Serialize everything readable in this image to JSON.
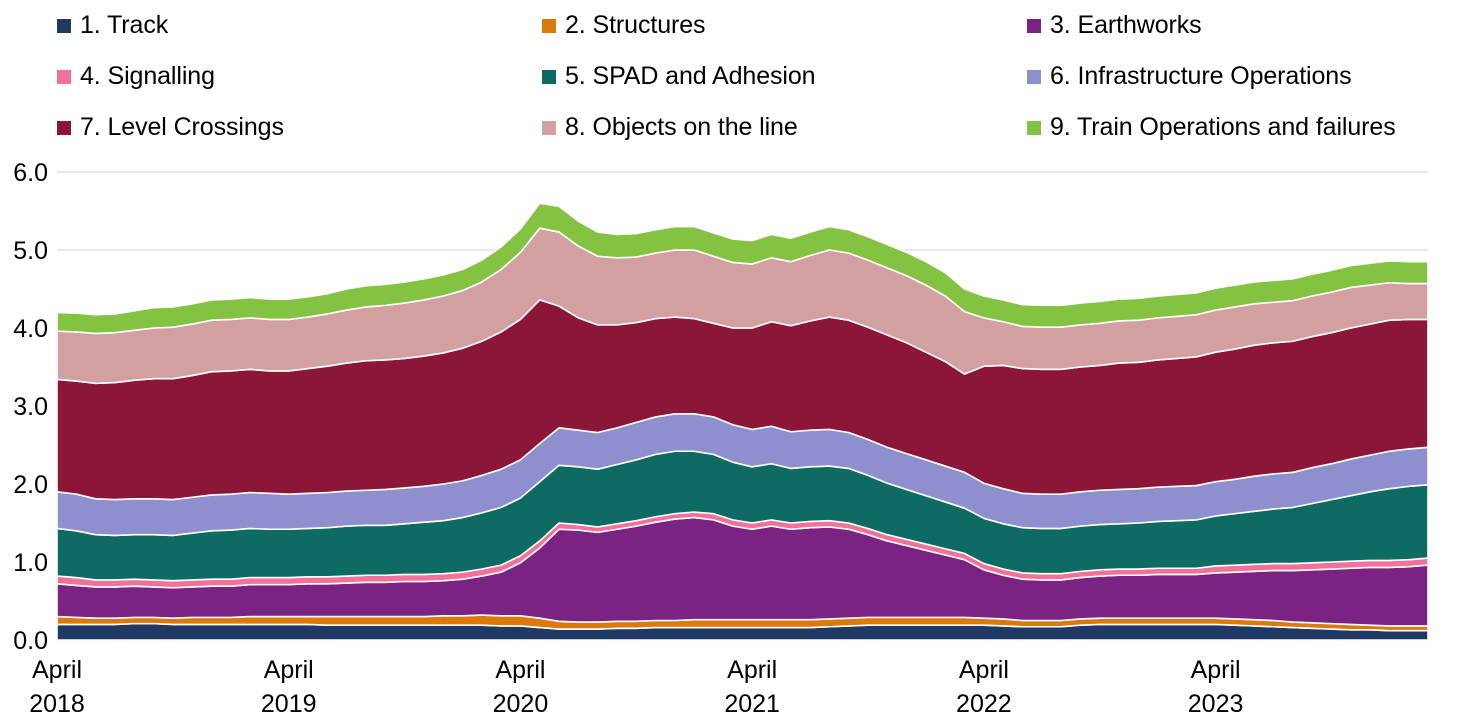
{
  "legend": {
    "position": "top",
    "items": [
      {
        "label": "1. Track",
        "color": "#1F3864",
        "icon": "square-swatch-icon"
      },
      {
        "label": "2. Structures",
        "color": "#D97A0B",
        "icon": "square-swatch-icon"
      },
      {
        "label": "3. Earthworks",
        "color": "#7B2382",
        "icon": "square-swatch-icon"
      },
      {
        "label": "4. Signalling",
        "color": "#F2719B",
        "icon": "square-swatch-icon"
      },
      {
        "label": "5. SPAD and Adhesion",
        "color": "#0D6B63",
        "icon": "square-swatch-icon"
      },
      {
        "label": "6. Infrastructure Operations",
        "color": "#8E90CE",
        "icon": "square-swatch-icon"
      },
      {
        "label": "7. Level Crossings",
        "color": "#8C1637",
        "icon": "square-swatch-icon"
      },
      {
        "label": "8. Objects on the line",
        "color": "#D2A0A1",
        "icon": "square-swatch-icon"
      },
      {
        "label": "9. Train Operations and failures",
        "color": "#84C342",
        "icon": "square-swatch-icon"
      }
    ]
  },
  "axes": {
    "y": {
      "ticks": [
        "0.0",
        "1.0",
        "2.0",
        "3.0",
        "4.0",
        "5.0",
        "6.0"
      ],
      "min": 0,
      "max": 6,
      "grid": true
    },
    "x": {
      "ticks": [
        {
          "line1": "April",
          "line2": "2018"
        },
        {
          "line1": "April",
          "line2": "2019"
        },
        {
          "line1": "April",
          "line2": "2020"
        },
        {
          "line1": "April",
          "line2": "2021"
        },
        {
          "line1": "April",
          "line2": "2022"
        },
        {
          "line1": "April",
          "line2": "2023"
        }
      ],
      "tick_indices": [
        0,
        12,
        24,
        36,
        48,
        60
      ]
    }
  },
  "chart_data": {
    "type": "area",
    "stacked": true,
    "title": "",
    "subtitle": "",
    "xlabel": "",
    "ylabel": "",
    "ylim": [
      0,
      6
    ],
    "grid": true,
    "legend_position": "top",
    "x_tick_labels": [
      "April 2018",
      "April 2019",
      "April 2020",
      "April 2021",
      "April 2022",
      "April 2023"
    ],
    "x_tick_indices": [
      0,
      12,
      24,
      36,
      48,
      60
    ],
    "n_points": 72,
    "x_start": "April 2018",
    "x_end": "March 2024",
    "x_interval": "monthly",
    "series": [
      {
        "name": "1. Track",
        "color": "#1F3864",
        "values": [
          0.2,
          0.2,
          0.2,
          0.2,
          0.21,
          0.21,
          0.2,
          0.2,
          0.2,
          0.2,
          0.2,
          0.2,
          0.2,
          0.2,
          0.19,
          0.19,
          0.19,
          0.19,
          0.19,
          0.19,
          0.19,
          0.19,
          0.19,
          0.18,
          0.18,
          0.16,
          0.14,
          0.14,
          0.14,
          0.15,
          0.15,
          0.16,
          0.16,
          0.16,
          0.16,
          0.16,
          0.16,
          0.16,
          0.16,
          0.16,
          0.17,
          0.18,
          0.19,
          0.19,
          0.19,
          0.19,
          0.19,
          0.19,
          0.19,
          0.18,
          0.17,
          0.17,
          0.17,
          0.19,
          0.2,
          0.2,
          0.2,
          0.2,
          0.2,
          0.2,
          0.2,
          0.19,
          0.18,
          0.17,
          0.16,
          0.15,
          0.14,
          0.13,
          0.13,
          0.12,
          0.12,
          0.12
        ]
      },
      {
        "name": "2. Structures",
        "color": "#D97A0B",
        "values": [
          0.1,
          0.09,
          0.08,
          0.08,
          0.08,
          0.08,
          0.08,
          0.09,
          0.09,
          0.09,
          0.1,
          0.1,
          0.1,
          0.1,
          0.11,
          0.11,
          0.11,
          0.11,
          0.11,
          0.11,
          0.12,
          0.12,
          0.13,
          0.13,
          0.13,
          0.12,
          0.1,
          0.09,
          0.09,
          0.09,
          0.09,
          0.09,
          0.09,
          0.1,
          0.1,
          0.1,
          0.1,
          0.1,
          0.1,
          0.1,
          0.1,
          0.1,
          0.1,
          0.1,
          0.1,
          0.1,
          0.1,
          0.1,
          0.09,
          0.09,
          0.08,
          0.08,
          0.08,
          0.08,
          0.08,
          0.08,
          0.08,
          0.08,
          0.08,
          0.08,
          0.08,
          0.08,
          0.08,
          0.08,
          0.07,
          0.07,
          0.07,
          0.07,
          0.06,
          0.06,
          0.06,
          0.06
        ]
      },
      {
        "name": "3. Earthworks",
        "color": "#7B2382",
        "values": [
          0.42,
          0.41,
          0.4,
          0.4,
          0.4,
          0.39,
          0.39,
          0.39,
          0.4,
          0.4,
          0.41,
          0.41,
          0.41,
          0.42,
          0.42,
          0.43,
          0.44,
          0.44,
          0.45,
          0.45,
          0.45,
          0.47,
          0.5,
          0.56,
          0.68,
          0.9,
          1.18,
          1.18,
          1.15,
          1.18,
          1.22,
          1.26,
          1.3,
          1.31,
          1.28,
          1.2,
          1.16,
          1.2,
          1.16,
          1.18,
          1.18,
          1.14,
          1.06,
          0.98,
          0.92,
          0.86,
          0.8,
          0.74,
          0.62,
          0.56,
          0.53,
          0.52,
          0.52,
          0.53,
          0.54,
          0.55,
          0.55,
          0.56,
          0.56,
          0.56,
          0.58,
          0.6,
          0.62,
          0.64,
          0.66,
          0.68,
          0.7,
          0.72,
          0.74,
          0.75,
          0.76,
          0.78
        ]
      },
      {
        "name": "4. Signalling",
        "color": "#F2719B",
        "values": [
          0.1,
          0.1,
          0.09,
          0.09,
          0.09,
          0.09,
          0.09,
          0.09,
          0.09,
          0.09,
          0.09,
          0.09,
          0.09,
          0.09,
          0.09,
          0.09,
          0.09,
          0.09,
          0.09,
          0.09,
          0.09,
          0.09,
          0.09,
          0.09,
          0.09,
          0.09,
          0.08,
          0.07,
          0.07,
          0.07,
          0.07,
          0.07,
          0.07,
          0.07,
          0.08,
          0.08,
          0.08,
          0.08,
          0.08,
          0.08,
          0.08,
          0.08,
          0.08,
          0.08,
          0.08,
          0.08,
          0.08,
          0.08,
          0.08,
          0.08,
          0.08,
          0.08,
          0.08,
          0.08,
          0.08,
          0.08,
          0.08,
          0.08,
          0.08,
          0.08,
          0.09,
          0.09,
          0.09,
          0.09,
          0.09,
          0.09,
          0.09,
          0.09,
          0.09,
          0.09,
          0.09,
          0.09
        ]
      },
      {
        "name": "5. SPAD and Adhesion",
        "color": "#0D6B63",
        "values": [
          0.61,
          0.6,
          0.58,
          0.57,
          0.57,
          0.58,
          0.58,
          0.6,
          0.62,
          0.63,
          0.63,
          0.62,
          0.62,
          0.62,
          0.63,
          0.64,
          0.64,
          0.64,
          0.65,
          0.67,
          0.68,
          0.7,
          0.72,
          0.74,
          0.74,
          0.76,
          0.74,
          0.74,
          0.74,
          0.76,
          0.78,
          0.8,
          0.8,
          0.78,
          0.76,
          0.74,
          0.72,
          0.72,
          0.7,
          0.7,
          0.7,
          0.7,
          0.68,
          0.66,
          0.64,
          0.62,
          0.6,
          0.58,
          0.58,
          0.58,
          0.58,
          0.58,
          0.58,
          0.58,
          0.58,
          0.58,
          0.59,
          0.6,
          0.61,
          0.62,
          0.64,
          0.66,
          0.68,
          0.7,
          0.72,
          0.76,
          0.8,
          0.84,
          0.88,
          0.92,
          0.94,
          0.94
        ]
      },
      {
        "name": "6. Infrastructure Operations",
        "color": "#8E90CE",
        "values": [
          0.47,
          0.47,
          0.46,
          0.46,
          0.46,
          0.46,
          0.46,
          0.46,
          0.46,
          0.46,
          0.46,
          0.46,
          0.45,
          0.45,
          0.45,
          0.45,
          0.45,
          0.46,
          0.46,
          0.46,
          0.47,
          0.47,
          0.48,
          0.49,
          0.49,
          0.49,
          0.48,
          0.47,
          0.47,
          0.47,
          0.48,
          0.48,
          0.48,
          0.48,
          0.48,
          0.48,
          0.48,
          0.48,
          0.47,
          0.47,
          0.47,
          0.46,
          0.46,
          0.46,
          0.46,
          0.46,
          0.46,
          0.46,
          0.45,
          0.45,
          0.44,
          0.44,
          0.44,
          0.44,
          0.44,
          0.44,
          0.44,
          0.44,
          0.44,
          0.44,
          0.44,
          0.44,
          0.45,
          0.45,
          0.45,
          0.46,
          0.46,
          0.47,
          0.47,
          0.48,
          0.48,
          0.48
        ]
      },
      {
        "name": "7. Level Crossings",
        "color": "#8C1637",
        "values": [
          1.44,
          1.45,
          1.48,
          1.5,
          1.52,
          1.54,
          1.55,
          1.56,
          1.58,
          1.58,
          1.58,
          1.57,
          1.58,
          1.6,
          1.62,
          1.64,
          1.66,
          1.66,
          1.66,
          1.67,
          1.68,
          1.7,
          1.72,
          1.76,
          1.8,
          1.84,
          1.56,
          1.44,
          1.38,
          1.32,
          1.28,
          1.26,
          1.24,
          1.22,
          1.2,
          1.24,
          1.3,
          1.34,
          1.36,
          1.4,
          1.44,
          1.44,
          1.44,
          1.44,
          1.42,
          1.38,
          1.34,
          1.26,
          1.5,
          1.58,
          1.6,
          1.6,
          1.6,
          1.6,
          1.6,
          1.62,
          1.62,
          1.63,
          1.64,
          1.65,
          1.66,
          1.67,
          1.68,
          1.68,
          1.68,
          1.68,
          1.68,
          1.68,
          1.68,
          1.68,
          1.66,
          1.64
        ]
      },
      {
        "name": "8. Objects on the line",
        "color": "#D2A0A1",
        "values": [
          0.62,
          0.63,
          0.64,
          0.64,
          0.64,
          0.65,
          0.66,
          0.66,
          0.66,
          0.66,
          0.66,
          0.66,
          0.66,
          0.66,
          0.67,
          0.68,
          0.69,
          0.7,
          0.71,
          0.72,
          0.73,
          0.74,
          0.76,
          0.8,
          0.86,
          0.92,
          0.95,
          0.92,
          0.88,
          0.86,
          0.84,
          0.84,
          0.86,
          0.88,
          0.86,
          0.84,
          0.82,
          0.82,
          0.82,
          0.84,
          0.86,
          0.86,
          0.86,
          0.86,
          0.86,
          0.86,
          0.84,
          0.8,
          0.62,
          0.56,
          0.54,
          0.54,
          0.54,
          0.54,
          0.54,
          0.54,
          0.54,
          0.54,
          0.54,
          0.54,
          0.54,
          0.54,
          0.53,
          0.52,
          0.52,
          0.52,
          0.52,
          0.52,
          0.5,
          0.48,
          0.46,
          0.46
        ]
      },
      {
        "name": "9. Train Operations and failures",
        "color": "#84C342",
        "values": [
          0.24,
          0.24,
          0.24,
          0.24,
          0.25,
          0.26,
          0.26,
          0.26,
          0.26,
          0.26,
          0.26,
          0.26,
          0.26,
          0.26,
          0.26,
          0.27,
          0.27,
          0.27,
          0.27,
          0.27,
          0.27,
          0.27,
          0.28,
          0.29,
          0.3,
          0.32,
          0.33,
          0.32,
          0.31,
          0.3,
          0.3,
          0.3,
          0.3,
          0.3,
          0.3,
          0.3,
          0.3,
          0.3,
          0.3,
          0.3,
          0.3,
          0.3,
          0.3,
          0.3,
          0.3,
          0.3,
          0.3,
          0.29,
          0.28,
          0.28,
          0.28,
          0.28,
          0.28,
          0.28,
          0.28,
          0.28,
          0.28,
          0.28,
          0.28,
          0.28,
          0.28,
          0.28,
          0.28,
          0.28,
          0.28,
          0.28,
          0.28,
          0.28,
          0.28,
          0.28,
          0.28,
          0.28
        ]
      }
    ]
  }
}
